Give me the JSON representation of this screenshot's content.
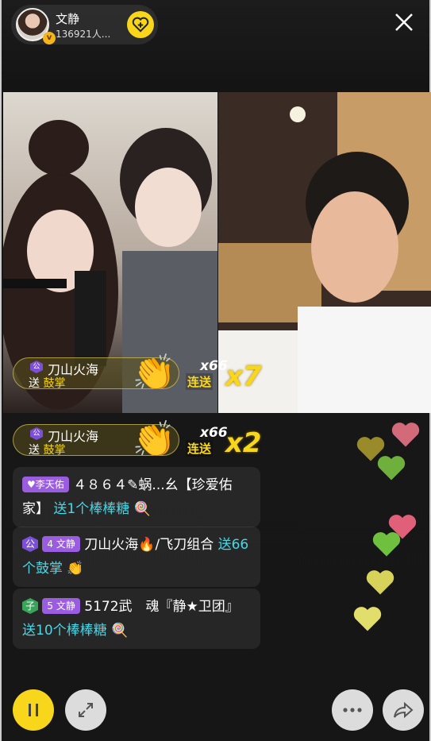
{
  "host": {
    "name": "文静",
    "viewers": "136921人..."
  },
  "combos": [
    {
      "rank": "公",
      "user": "刀山火海",
      "action_prefix": "送",
      "gift": "鼓掌",
      "count": "x66",
      "combo_label": "连送",
      "multiplier": "x7"
    },
    {
      "rank": "公",
      "user": "刀山火海",
      "action_prefix": "送",
      "gift": "鼓掌",
      "count": "x66",
      "combo_label": "连送",
      "multiplier": "x2"
    }
  ],
  "chat": [
    {
      "badge": "♥李天佑",
      "text": "４８６４✎蜗...幺【珍爱佑家】",
      "gift_text": "送1个棒棒糖",
      "gift_icon": "lollipop-icon"
    },
    {
      "rank": "公",
      "level": "4",
      "level_name": "文静",
      "text": "刀山火海🔥/飞刀组合",
      "gift_text": "送66个鼓掌",
      "gift_icon": "clap-icon"
    },
    {
      "rank": "子",
      "level": "5",
      "level_name": "文静",
      "text": "5172武　魂『静★卫团』",
      "gift_text": "送10个棒棒糖",
      "gift_icon": "lollipop-icon"
    }
  ],
  "colors": {
    "accent": "#f7d61b",
    "gift_text": "#48d7e6"
  },
  "controls": [
    "pause-button",
    "expand-button",
    "more-button",
    "share-button"
  ]
}
